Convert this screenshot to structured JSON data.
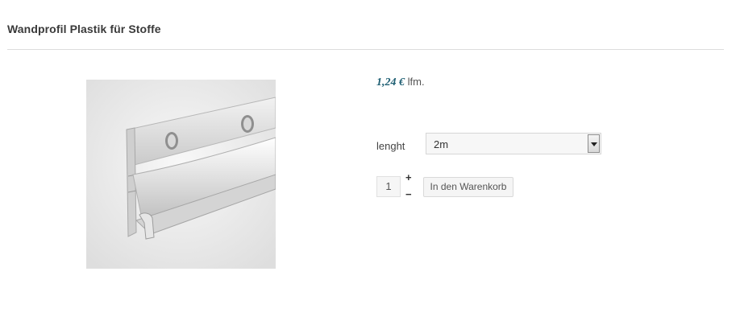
{
  "product": {
    "title": "Wandprofil Plastik für Stoffe",
    "price_amount": "1,24 €",
    "price_unit": "lfm.",
    "image_icon": "wall-profile-image"
  },
  "options": {
    "length_label": "lenght",
    "length_value": "2m"
  },
  "cart": {
    "quantity": "1",
    "plus_label": "+",
    "minus_label": "−",
    "button_label": "In den Warenkorb"
  },
  "colors": {
    "price": "#1f5f73",
    "divider": "#dcdcdc"
  }
}
